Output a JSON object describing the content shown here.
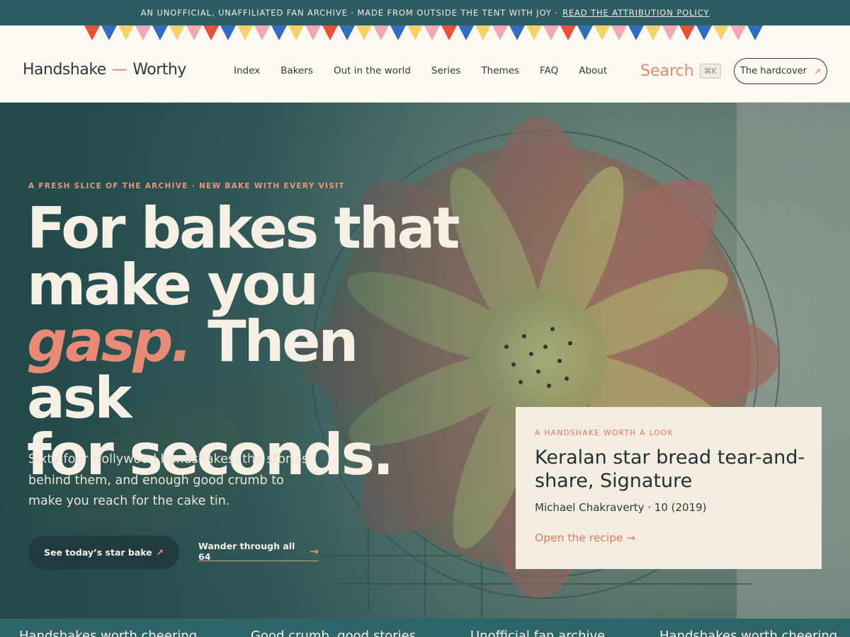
{
  "topbar": {
    "text": "An unofficial, unaffiliated fan archive · Made from outside the tent with joy ·",
    "link": "Read the attribution policy"
  },
  "bunting_colors": [
    "#e8503a",
    "#2f6dbf",
    "#f2d36a",
    "#f1a7b7",
    "#2f6dbf",
    "#f2d36a",
    "#f1a7b7"
  ],
  "header": {
    "brand_left": "Handshake",
    "brand_dash": "—",
    "brand_right": "Worthy",
    "nav": [
      "Index",
      "Bakers",
      "Out in the world",
      "Series",
      "Themes",
      "FAQ",
      "About"
    ],
    "search_label": "Search",
    "search_shortcut": "⌘K",
    "hardcover_label": "The hardcover",
    "hardcover_icon": "↗"
  },
  "hero": {
    "eyebrow": "A fresh slice of the archive · New bake with every visit",
    "headline_1": "For bakes that",
    "headline_2": "make you",
    "headline_em": "gasp.",
    "headline_3": " Then ask",
    "headline_4": "for seconds.",
    "lede": "Sixty-four Hollywood handshakes, the stories behind them, and enough good crumb to make you reach for the cake tin.",
    "primary_cta": "See today’s star bake",
    "primary_icon": "↗",
    "secondary_cta": "Wander through all 64",
    "secondary_icon": "→"
  },
  "card": {
    "eyebrow": "A handshake worth a look",
    "title": "Keralan star bread tear-and-share, Signature",
    "meta": "Michael Chakraverty · 10 (2019)",
    "link": "Open the recipe →"
  },
  "ticker": [
    "Handshakes worth cheering",
    "Good crumb, good stories",
    "Unofficial fan archive",
    "Handshakes worth cheering"
  ],
  "colors": {
    "accent": "#e07a5f",
    "teal": "#2d5d62",
    "cream": "#fdf8f1",
    "ink": "#2d3b3c"
  }
}
